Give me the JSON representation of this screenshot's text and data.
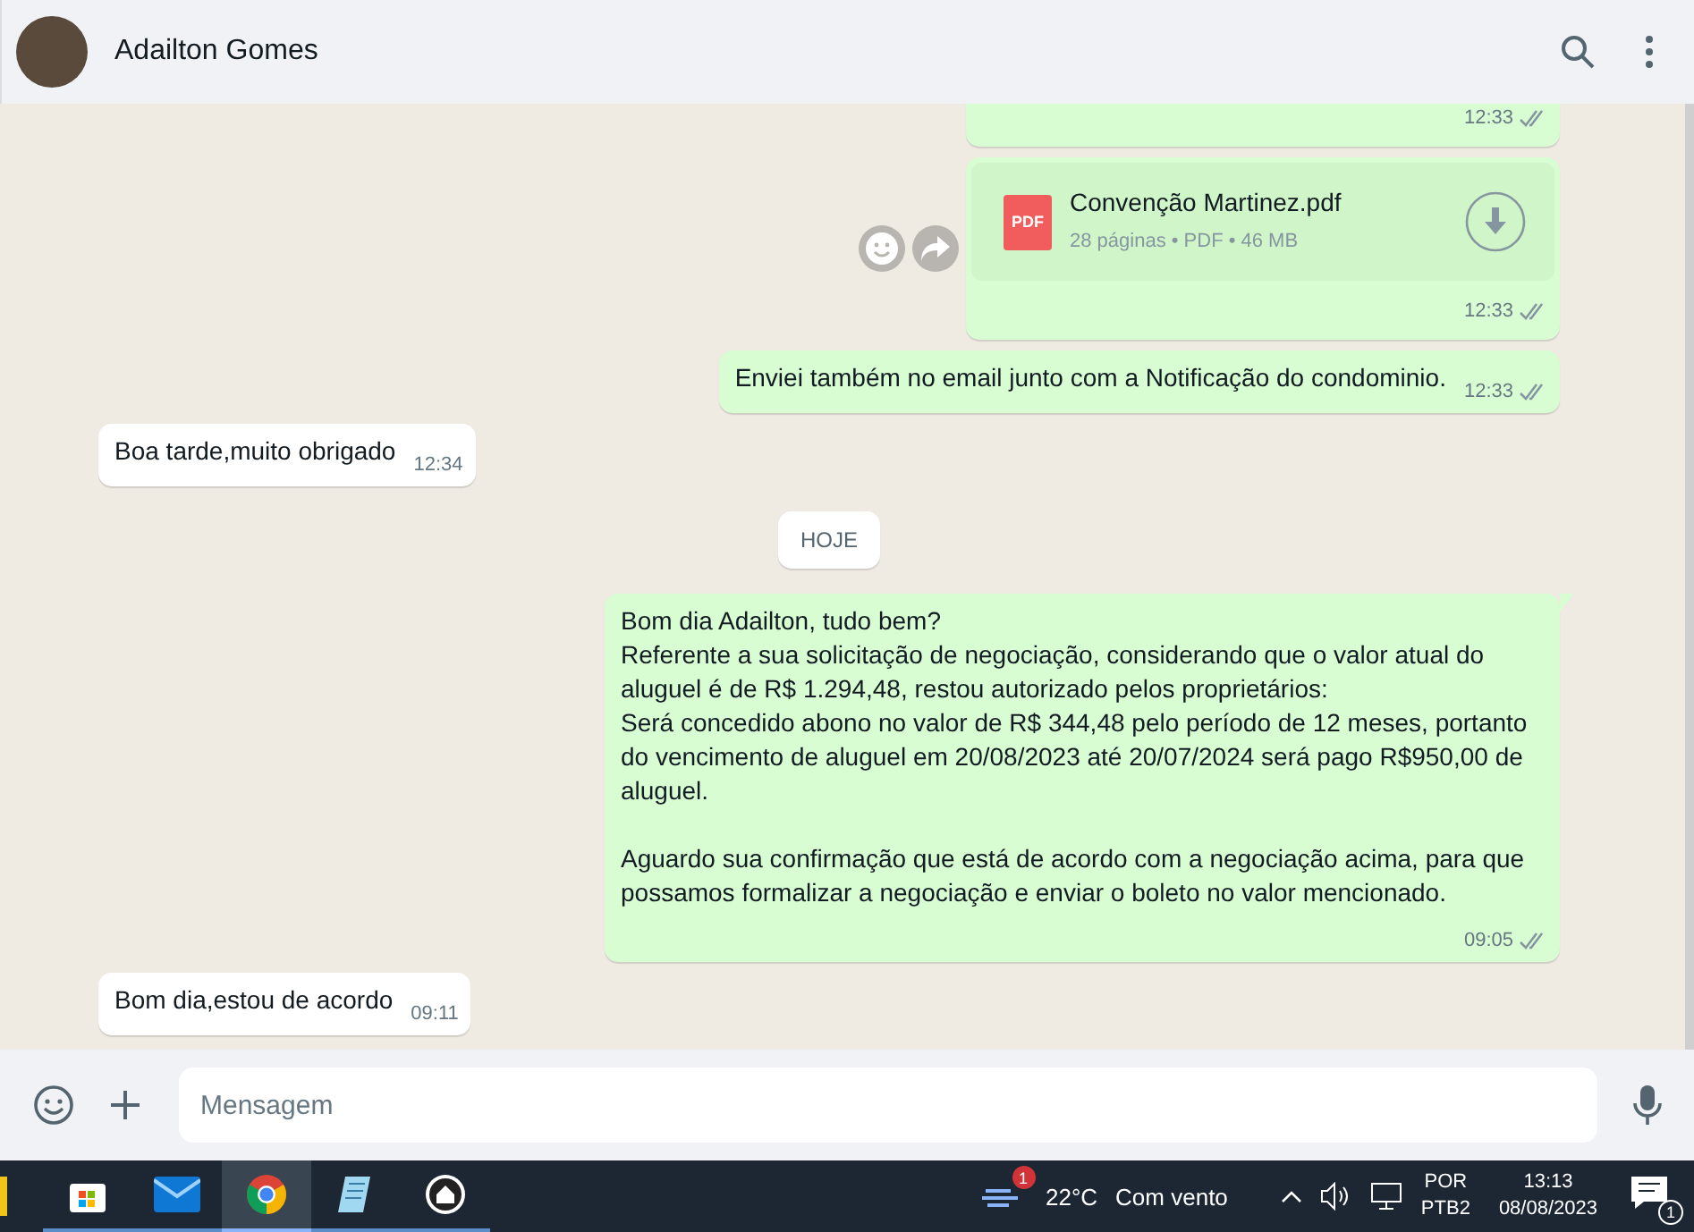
{
  "header": {
    "contact_name": "Adailton Gomes"
  },
  "messages": [
    {
      "kind": "file",
      "outgoing": true,
      "time": "12:33",
      "delivered": true,
      "cut": true
    },
    {
      "kind": "file",
      "outgoing": true,
      "time": "12:33",
      "delivered": true,
      "file_name": "Convenção Martinez.pdf",
      "file_meta": "28 páginas • PDF • 46 MB",
      "file_type": "PDF",
      "show_actions": true
    },
    {
      "kind": "text",
      "outgoing": true,
      "time": "12:33",
      "delivered": true,
      "text": "Enviei também no email junto com a Notificação do condominio."
    },
    {
      "kind": "text",
      "outgoing": false,
      "time": "12:34",
      "text": "Boa tarde,muito obrigado"
    },
    {
      "kind": "date",
      "text": "HOJE"
    },
    {
      "kind": "text",
      "outgoing": true,
      "time": "09:05",
      "delivered": true,
      "tail": true,
      "text": "Bom dia Adailton, tudo bem?\nReferente a sua solicitação de negociação, considerando que o valor atual do aluguel é de R$ 1.294,48, restou autorizado pelos proprietários:\nSerá concedido abono no valor de R$ 344,48 pelo período de 12 meses, portanto do vencimento de aluguel em 20/08/2023 até 20/07/2024 será pago R$950,00 de aluguel.\n\nAguardo sua confirmação que está de acordo com a negociação acima, para que possamos formalizar a negociação e enviar o boleto no valor mencionado."
    },
    {
      "kind": "text",
      "outgoing": false,
      "time": "09:11",
      "text": "Bom dia,estou de acordo"
    }
  ],
  "composer": {
    "placeholder": "Mensagem"
  },
  "taskbar": {
    "apps": [
      {
        "kind": "store",
        "selected": false
      },
      {
        "kind": "mail",
        "selected": false
      },
      {
        "kind": "chrome",
        "selected": true
      },
      {
        "kind": "notepad",
        "selected": false
      },
      {
        "kind": "home",
        "selected": false
      }
    ],
    "weather_badge": "1",
    "temperature": "22°C",
    "weather_text": "Com vento",
    "language": "POR",
    "layout": "PTB2",
    "time": "13:13",
    "date": "08/08/2023",
    "notification_count": "1"
  }
}
